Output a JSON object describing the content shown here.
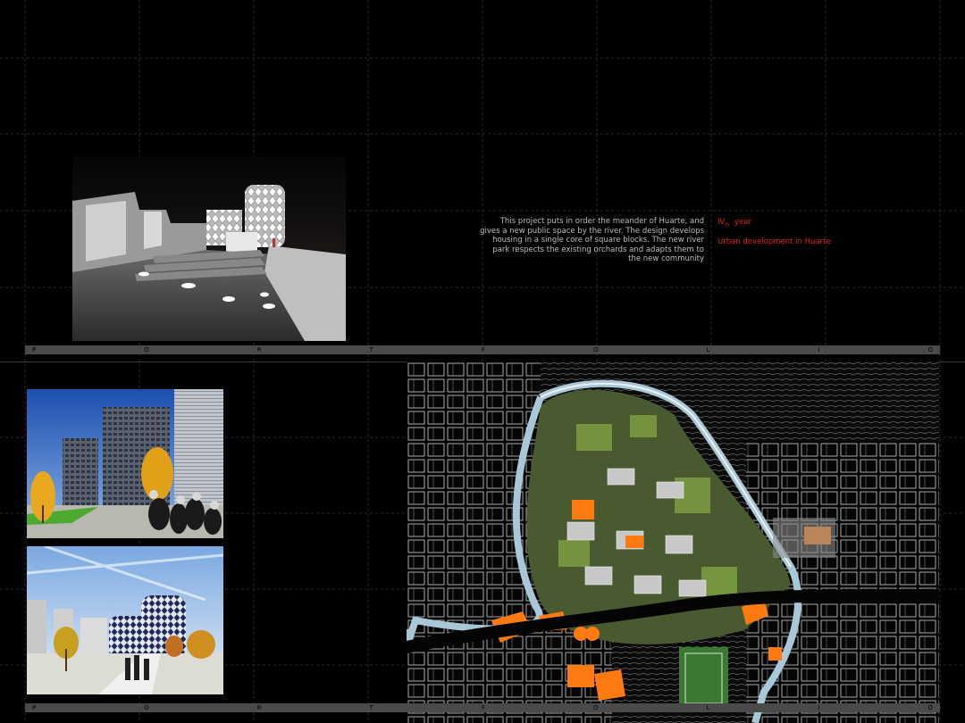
{
  "description_lines": [
    "This project puts in order the meander of Huarte, and",
    "gives a new public space by the river. The design develops",
    "housing in a single core of square blocks. The new river",
    "park respects the existing orchards and adapts them to",
    "the new community"
  ],
  "year": {
    "main": "IV",
    "sub": "th",
    "suffix": "year"
  },
  "project_title": "Urban development in Huarte",
  "band_letters": [
    "P",
    "O",
    "R",
    "T",
    "F",
    "O",
    "L",
    "I",
    "O"
  ],
  "colors": {
    "accent": "#e02020",
    "band": "#4a4a4a",
    "orange": "#ff7a10"
  },
  "images": [
    "night-plaza-render",
    "housing-towers-render",
    "lattice-buildings-render",
    "master-plan-map"
  ]
}
